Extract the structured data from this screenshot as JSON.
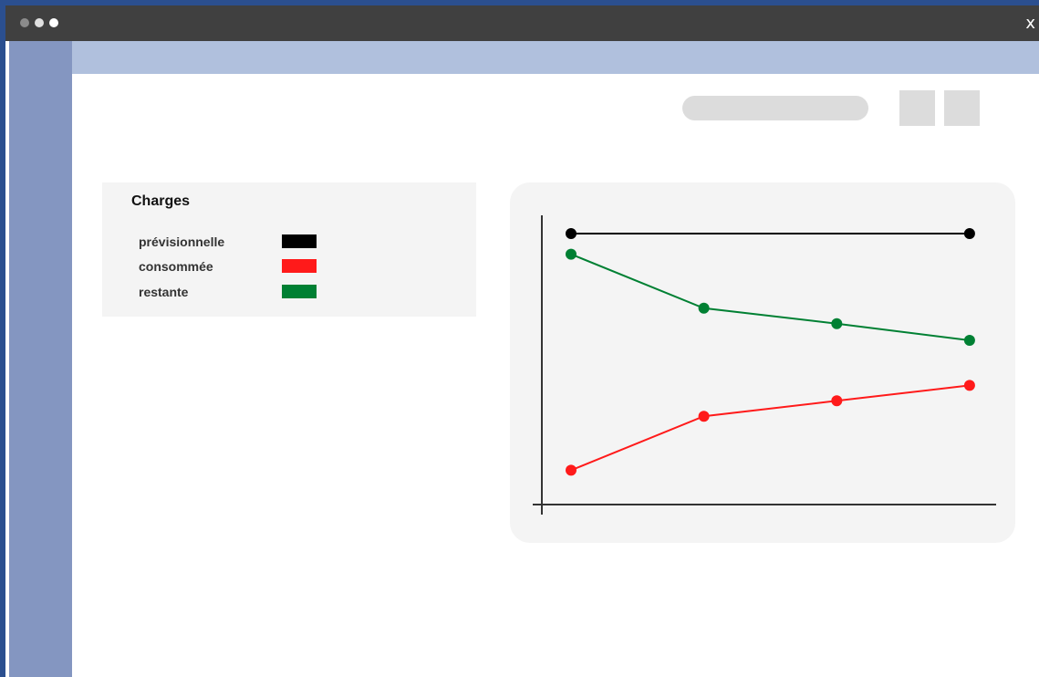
{
  "window": {
    "close_label": "x",
    "dot_colors": [
      "#8c8c8c",
      "#e0e0e0",
      "#ffffff"
    ]
  },
  "legend": {
    "title": "Charges",
    "items": [
      {
        "label": "prévisionnelle",
        "color": "#000000"
      },
      {
        "label": "consommée",
        "color": "#ff1a1a"
      },
      {
        "label": "restante",
        "color": "#008033"
      }
    ]
  },
  "chart_data": {
    "type": "line",
    "x": [
      1,
      2,
      3,
      4
    ],
    "xlim": [
      0.78,
      4.2
    ],
    "ylim": [
      0,
      100
    ],
    "grid": false,
    "series": [
      {
        "name": "prévisionnelle",
        "color": "#000000",
        "points": [
          [
            1,
            100
          ],
          [
            4,
            100
          ]
        ]
      },
      {
        "name": "restante",
        "color": "#008033",
        "points": [
          [
            1,
            92
          ],
          [
            2,
            71
          ],
          [
            3,
            65
          ],
          [
            4,
            58.5
          ]
        ]
      },
      {
        "name": "consommée",
        "color": "#ff1a1a",
        "points": [
          [
            1,
            8
          ],
          [
            2,
            29
          ],
          [
            3,
            35
          ],
          [
            4,
            41
          ]
        ]
      }
    ]
  }
}
